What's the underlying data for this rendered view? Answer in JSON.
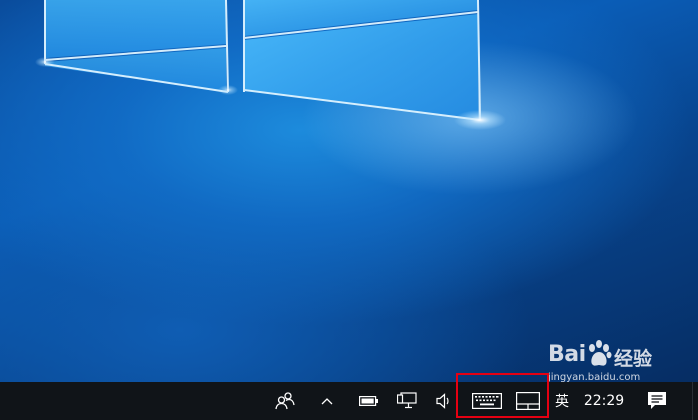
{
  "desktop": {
    "wallpaper": "Windows 10 light window",
    "colors": {
      "deep_blue": "#062d63",
      "mid_blue": "#0a5db7",
      "light_blue": "#1d8bdc",
      "glow": "#bfe6ff"
    }
  },
  "taskbar": {
    "background": "#101418",
    "icons": [
      {
        "name": "people-icon"
      },
      {
        "name": "chevron-up-icon"
      },
      {
        "name": "battery-icon"
      },
      {
        "name": "network-icon"
      },
      {
        "name": "volume-icon"
      },
      {
        "name": "keyboard-icon"
      },
      {
        "name": "touchpad-icon"
      },
      {
        "name": "action-center-icon"
      }
    ],
    "language": "英",
    "time": "22:29"
  },
  "highlight": {
    "color": "#e60012"
  },
  "watermark": {
    "brand_left": "Bai",
    "brand_right": "经验",
    "url": "jingyan.baidu.com"
  }
}
